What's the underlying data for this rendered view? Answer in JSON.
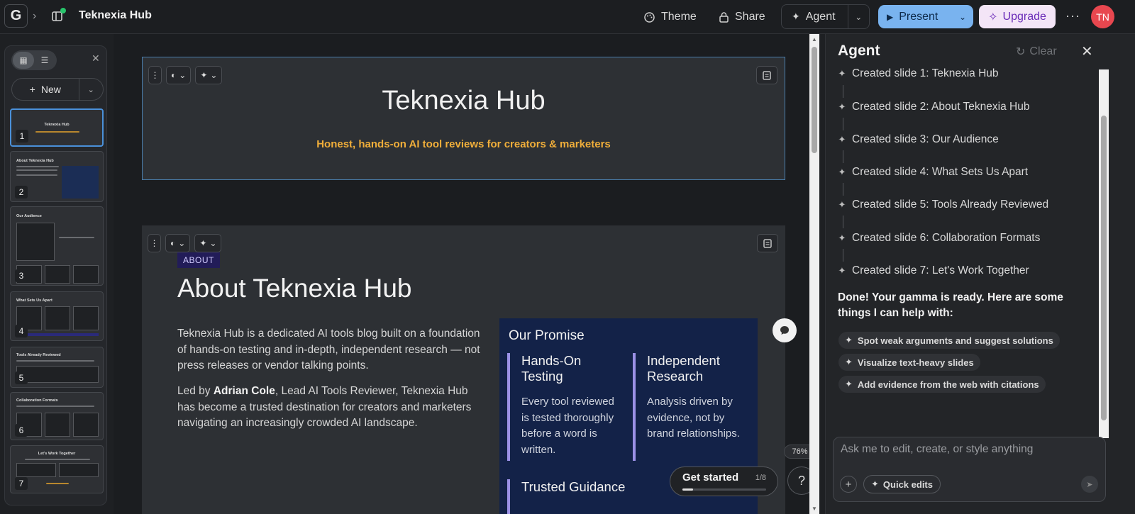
{
  "topbar": {
    "doc_title": "Teknexia Hub",
    "theme_label": "Theme",
    "share_label": "Share",
    "agent_label": "Agent",
    "present_label": "Present",
    "upgrade_label": "Upgrade",
    "avatar_initials": "TN"
  },
  "sidebar": {
    "new_label": "New",
    "thumbnails": [
      {
        "number": "1",
        "title": "Teknexia Hub"
      },
      {
        "number": "2",
        "title": "About Teknexia Hub"
      },
      {
        "number": "3",
        "title": "Our Audience"
      },
      {
        "number": "4",
        "title": "What Sets Us Apart"
      },
      {
        "number": "5",
        "title": "Tools Already Reviewed"
      },
      {
        "number": "6",
        "title": "Collaboration Formats"
      },
      {
        "number": "7",
        "title": "Let's Work Together"
      }
    ]
  },
  "slide1": {
    "title": "Teknexia Hub",
    "subtitle": "Honest, hands-on AI tool reviews for creators & marketers"
  },
  "slide2": {
    "badge": "ABOUT",
    "title": "About Teknexia Hub",
    "para1": "Teknexia Hub is a dedicated AI tools blog built on a foundation of hands-on testing and in-depth, independent research — not press releases or vendor talking points.",
    "para2_prefix": "Led by ",
    "para2_name": "Adrian Cole",
    "para2_suffix": ", Lead AI Tools Reviewer, Teknexia Hub has become a trusted destination for creators and marketers navigating an increasingly crowded AI landscape.",
    "promise": {
      "heading": "Our Promise",
      "col1_heading": "Hands-On Testing",
      "col1_body": "Every tool reviewed is tested thoroughly before a word is written.",
      "col2_heading": "Independent Research",
      "col2_body": "Analysis driven by evidence, not by brand relationships.",
      "col3_heading": "Trusted Guidance"
    }
  },
  "canvas": {
    "zoom": "76%",
    "get_started": "Get started",
    "get_started_count": "1/8",
    "get_started_progress": 0.125,
    "help": "?"
  },
  "agent": {
    "title": "Agent",
    "clear_label": "Clear",
    "steps": [
      "Created slide 1: Teknexia Hub",
      "Created slide 2: About Teknexia Hub",
      "Created slide 3: Our Audience",
      "Created slide 4: What Sets Us Apart",
      "Created slide 5: Tools Already Reviewed",
      "Created slide 6: Collaboration Formats",
      "Created slide 7: Let's Work Together"
    ],
    "done_message": "Done! Your gamma is ready. Here are some things I can help with:",
    "suggestions": [
      "Spot weak arguments and suggest solutions",
      "Visualize text-heavy slides",
      "Add evidence from the web with citations"
    ],
    "input_placeholder": "Ask me to edit, create, or style anything",
    "quick_edits_label": "Quick edits"
  },
  "colors": {
    "accent_blue": "#79b3ef",
    "subtitle_orange": "#f0ae3a",
    "promise_navy": "#132248",
    "promise_bar": "#9b91e6",
    "avatar_red": "#e8474f"
  }
}
